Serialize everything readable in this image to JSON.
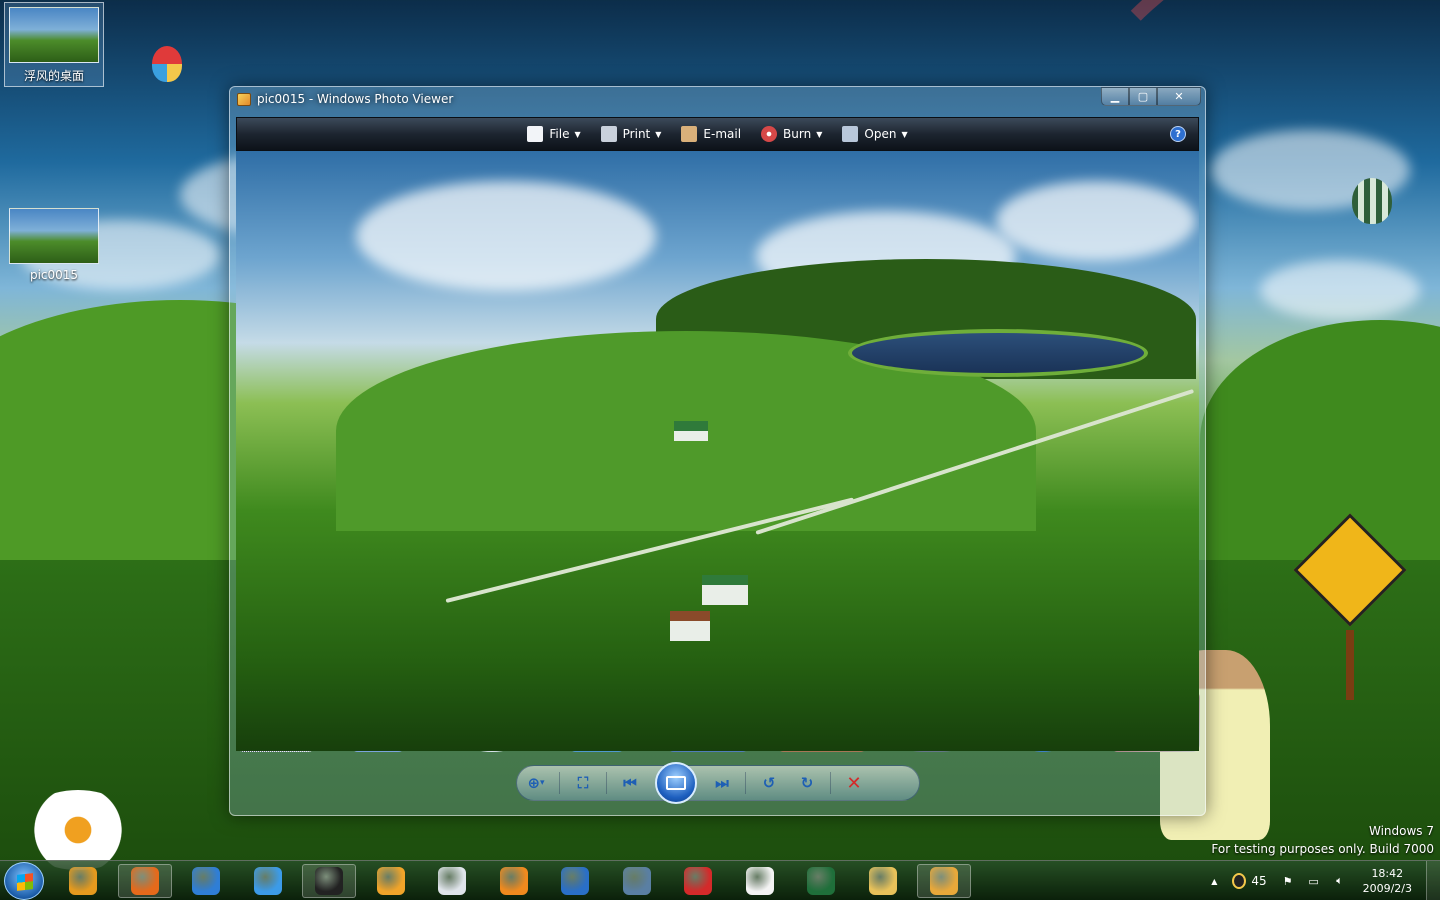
{
  "desktop": {
    "icons": [
      {
        "label": "浮风的桌面"
      },
      {
        "label": "pic0015"
      }
    ],
    "watermark": {
      "line1": "Windows 7",
      "line2": "For testing purposes only. Build 7000"
    }
  },
  "window": {
    "title": "pic0015 - Windows Photo Viewer",
    "controls": {
      "minimize": "▁",
      "maximize": "▢",
      "close": "✕"
    },
    "toolbar": {
      "items": [
        {
          "label": "File",
          "icon": "file-icon",
          "color": "#f2f4f8"
        },
        {
          "label": "Print",
          "icon": "printer-icon",
          "color": "#c9d1dc"
        },
        {
          "label": "E-mail",
          "icon": "email-icon",
          "color": "#d9b07a"
        },
        {
          "label": "Burn",
          "icon": "disc-icon",
          "color": "#d64848"
        },
        {
          "label": "Open",
          "icon": "open-icon",
          "color": "#b8c7da"
        }
      ],
      "help": "?"
    },
    "controlbar": {
      "zoom": "⊕",
      "zoom_caret": "▾",
      "fit": "⛶",
      "previous": "⏮",
      "next": "⏭",
      "rotate_ccw": "↺",
      "rotate_cw": "↻",
      "delete": "✕"
    }
  },
  "taskbar": {
    "apps": [
      {
        "name": "media-player-icon",
        "color": "#e59a1e"
      },
      {
        "name": "firefox-icon",
        "color": "#e56a1b",
        "active": true
      },
      {
        "name": "windows-media-center-icon",
        "color": "#2f7ed6"
      },
      {
        "name": "stock-app-icon",
        "color": "#3c9be8"
      },
      {
        "name": "qq-penguin-icon",
        "color": "#222222",
        "active": true
      },
      {
        "name": "chat-bubbles-icon",
        "color": "#f0a42a"
      },
      {
        "name": "mail-icon",
        "color": "#dfe4ea"
      },
      {
        "name": "video-player-icon",
        "color": "#f08a1e"
      },
      {
        "name": "audio-book-icon",
        "color": "#2a6fc7"
      },
      {
        "name": "film-strip-icon",
        "color": "#5a7fa3"
      },
      {
        "name": "cancel-x-icon",
        "color": "#d42a2a"
      },
      {
        "name": "key-icon",
        "color": "#f3f3f3"
      },
      {
        "name": "task-manager-icon",
        "color": "#1f6f3a"
      },
      {
        "name": "folder-icon",
        "color": "#e8c25a"
      },
      {
        "name": "photo-viewer-icon",
        "color": "#e8a83a",
        "active": true
      }
    ],
    "tray": {
      "up_arrow": "▲",
      "qq_badge": "45",
      "clock_time": "18:42",
      "clock_date": "2009/2/3"
    }
  }
}
